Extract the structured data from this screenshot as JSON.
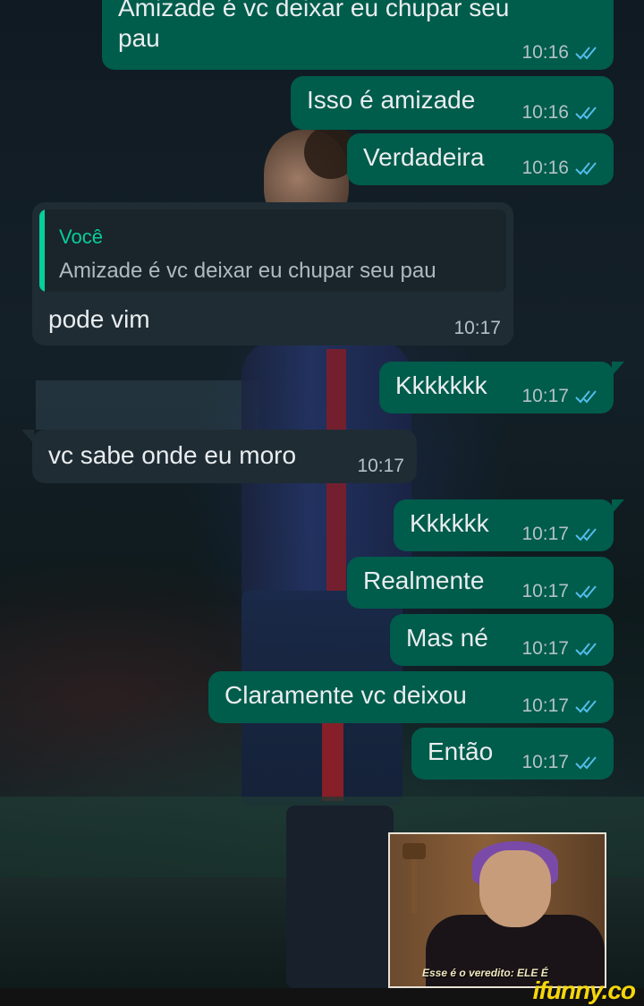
{
  "chat": {
    "messages": [
      {
        "direction": "out",
        "line1": "Amizade é vc deixar eu chupar seu",
        "line2": "pau",
        "time": "10:16",
        "read": true
      },
      {
        "direction": "out",
        "text": "Isso é amizade",
        "time": "10:16",
        "read": true
      },
      {
        "direction": "out",
        "text": "Verdadeira",
        "time": "10:16",
        "read": true
      },
      {
        "direction": "in",
        "quote_author": "Você",
        "quote_text": "Amizade é vc deixar eu chupar seu pau",
        "text": "pode vim",
        "time": "10:17"
      },
      {
        "direction": "out",
        "text": "Kkkkkkk",
        "time": "10:17",
        "read": true
      },
      {
        "direction": "in",
        "text": "vc sabe onde eu moro",
        "time": "10:17"
      },
      {
        "direction": "out",
        "text": "Kkkkkk",
        "time": "10:17",
        "read": true
      },
      {
        "direction": "out",
        "text": "Realmente",
        "time": "10:17",
        "read": true
      },
      {
        "direction": "out",
        "text": "Mas né",
        "time": "10:17",
        "read": true
      },
      {
        "direction": "out",
        "text": "Claramente vc deixou",
        "time": "10:17",
        "read": true
      },
      {
        "direction": "out",
        "text": "Então",
        "time": "10:17",
        "read": true
      }
    ],
    "sticker": {
      "caption": "Esse é o veredito: ELE É"
    }
  },
  "watermark": "ifunny.co",
  "colors": {
    "outgoing_bubble": "#005c4b",
    "incoming_bubble": "#1f2c34",
    "read_ticks": "#53bdeb",
    "quote_accent": "#06cf9c",
    "watermark": "#f5d60a"
  }
}
